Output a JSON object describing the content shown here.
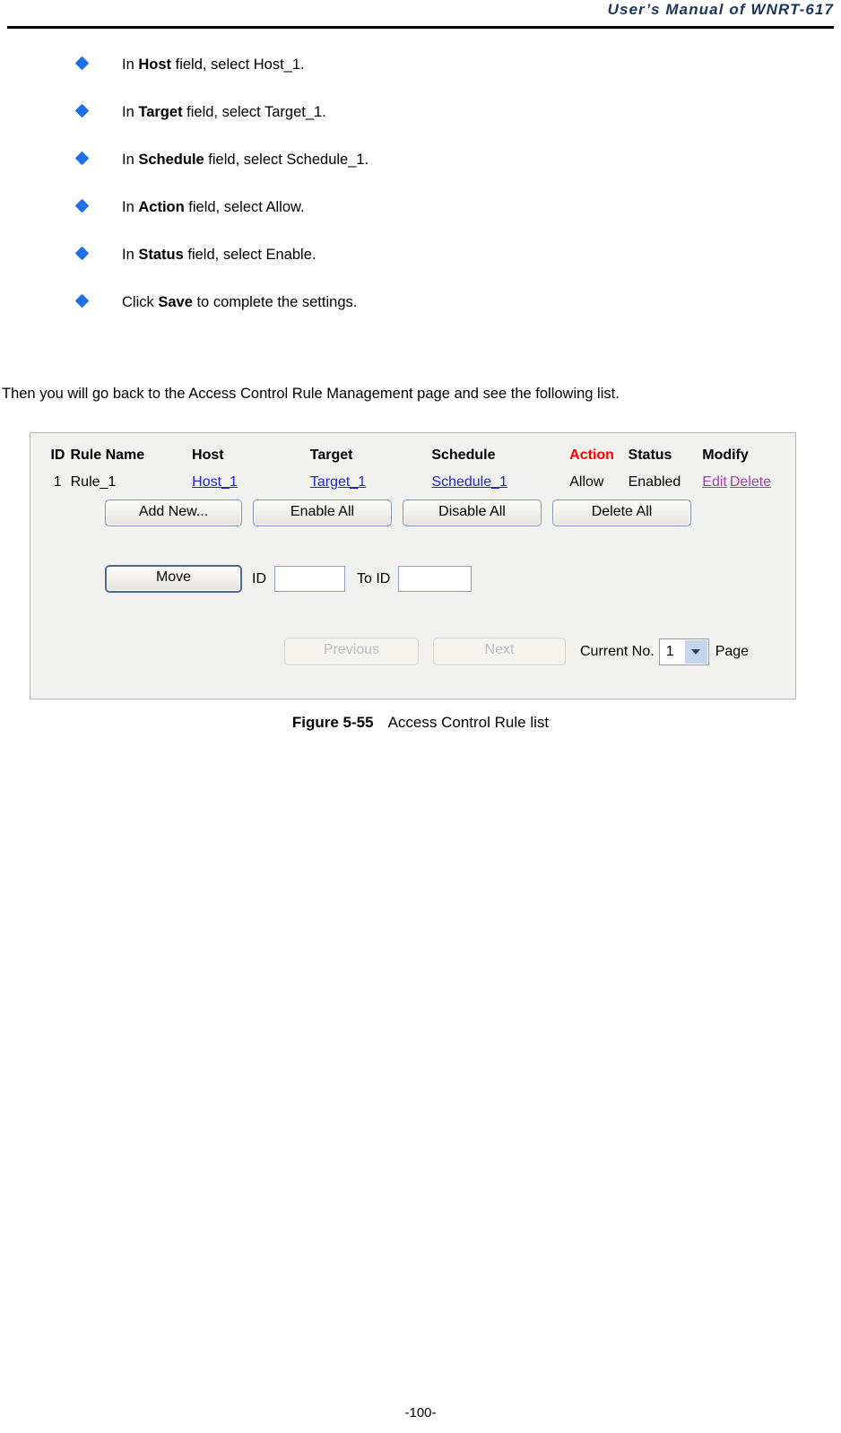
{
  "header": {
    "title": "User’s Manual of WNRT-617"
  },
  "bullets": [
    {
      "prefix": "In ",
      "bold": "Host",
      "suffix": " field, select Host_1."
    },
    {
      "prefix": "In ",
      "bold": "Target",
      "suffix": " field, select Target_1."
    },
    {
      "prefix": "In ",
      "bold": "Schedule",
      "suffix": " field, select Schedule_1."
    },
    {
      "prefix": "In ",
      "bold": "Action",
      "suffix": " field, select Allow."
    },
    {
      "prefix": "In ",
      "bold": "Status",
      "suffix": " field, select Enable."
    },
    {
      "prefix": "Click ",
      "bold": "Save",
      "suffix": " to complete the settings."
    }
  ],
  "paragraph": "Then you will go back to the Access Control Rule Management page and see the following list.",
  "figure": {
    "table": {
      "headers": {
        "id": "ID",
        "rule_name": "Rule Name",
        "host": "Host",
        "target": "Target",
        "schedule": "Schedule",
        "action": "Action",
        "status": "Status",
        "modify": "Modify"
      },
      "header_action_color": "#FF0000",
      "rows": [
        {
          "id": "1",
          "rule_name": "Rule_1",
          "host": "Host_1",
          "target": "Target_1",
          "schedule": "Schedule_1",
          "action": "Allow",
          "status": "Enabled",
          "edit": "Edit",
          "delete": "Delete"
        }
      ],
      "link_color": "#2323DC",
      "modify_link_color": "#A23FA2"
    },
    "buttons": {
      "add_new": "Add New...",
      "enable_all": "Enable All",
      "disable_all": "Disable All",
      "delete_all": "Delete All",
      "move": "Move"
    },
    "move_row": {
      "id_label": "ID",
      "id_value": "",
      "id_placeholder": "",
      "to_id_label": "To ID",
      "to_id_value": "",
      "to_id_placeholder": ""
    },
    "pager": {
      "previous": "Previous",
      "next": "Next",
      "current_label": "Current No.",
      "page_value": "1",
      "page_suffix": "Page",
      "select_arrow_icon": "chevron-down-icon"
    }
  },
  "caption": {
    "figure_number": "Figure 5-55",
    "figure_title": "Access Control Rule list"
  },
  "footer": {
    "page_number": "-100-"
  }
}
